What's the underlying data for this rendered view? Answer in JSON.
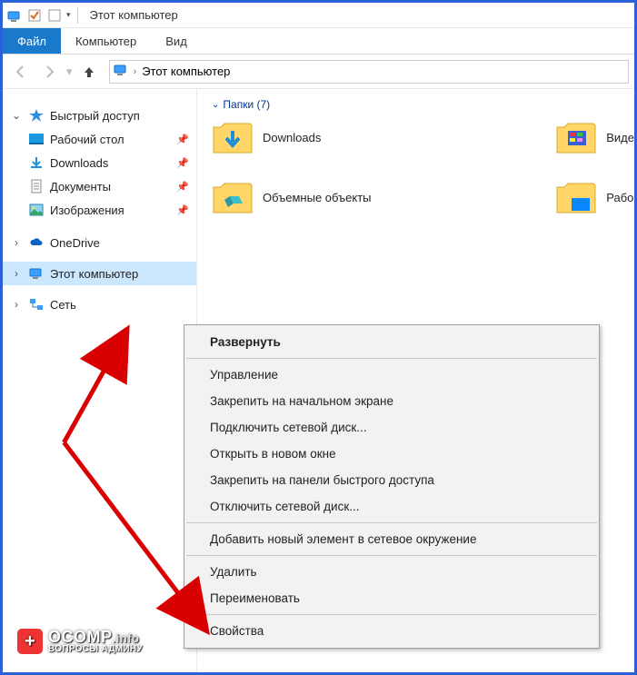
{
  "window": {
    "title": "Этот компьютер"
  },
  "ribbon": {
    "file": "Файл",
    "computer": "Компьютер",
    "view": "Вид"
  },
  "breadcrumb": {
    "root": "Этот компьютер"
  },
  "sidebar": {
    "quick": {
      "label": "Быстрый доступ"
    },
    "quick_items": [
      {
        "label": "Рабочий стол"
      },
      {
        "label": "Downloads"
      },
      {
        "label": "Документы"
      },
      {
        "label": "Изображения"
      }
    ],
    "onedrive": {
      "label": "OneDrive"
    },
    "thispc": {
      "label": "Этот компьютер"
    },
    "network": {
      "label": "Сеть"
    }
  },
  "content": {
    "section_title": "Папки (7)",
    "folders_col1": [
      {
        "label": "Downloads"
      },
      {
        "label": "Объемные объекты"
      }
    ],
    "folders_col2": [
      {
        "label": "Виде"
      },
      {
        "label": "Рабо"
      }
    ]
  },
  "context_menu": [
    {
      "type": "item",
      "label": "Развернуть",
      "bold": true
    },
    {
      "type": "sep"
    },
    {
      "type": "item",
      "label": "Управление"
    },
    {
      "type": "item",
      "label": "Закрепить на начальном экране"
    },
    {
      "type": "item",
      "label": "Подключить сетевой диск..."
    },
    {
      "type": "item",
      "label": "Открыть в новом окне"
    },
    {
      "type": "item",
      "label": "Закрепить на панели быстрого доступа"
    },
    {
      "type": "item",
      "label": "Отключить сетевой диск..."
    },
    {
      "type": "sep"
    },
    {
      "type": "item",
      "label": "Добавить новый элемент в сетевое окружение"
    },
    {
      "type": "sep"
    },
    {
      "type": "item",
      "label": "Удалить"
    },
    {
      "type": "item",
      "label": "Переименовать"
    },
    {
      "type": "sep"
    },
    {
      "type": "item",
      "label": "Свойства"
    }
  ],
  "watermark": {
    "brand": "OCOMP",
    "suffix": ".info",
    "subtitle": "ВОПРОСЫ АДМИНУ"
  }
}
